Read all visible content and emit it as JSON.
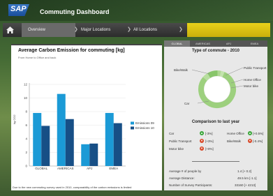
{
  "header": {
    "logo_text": "SAP",
    "title": "Commuting Dashboard"
  },
  "nav": {
    "items": [
      {
        "label": "Overview",
        "active": true
      },
      {
        "label": "Major Locations",
        "active": false
      },
      {
        "label": "All Locations",
        "active": false
      }
    ]
  },
  "left_panel": {
    "title": "Average Carbon Emission for commuting [kg]",
    "subtitle": "From Home to Office and back",
    "footnote": "Due to the new commuting survey used in 2010, comparability of the carbon emissions is limited"
  },
  "right_panel": {
    "tabs": [
      "GLOBAL",
      "AMERICAS",
      "APJ",
      "EMEA"
    ],
    "active_tab": "GLOBAL",
    "donut_title": "Type of commute - 2010",
    "donut_labels": [
      "Bike/Walk",
      "Public Transport",
      "Home Office",
      "Motor bike",
      "Car"
    ],
    "compare_title": "Comparison to last year",
    "comparison": [
      {
        "label": "Car",
        "value": "[-3%]",
        "trend": "up"
      },
      {
        "label": "Home Office",
        "value": "[+0.5%]",
        "trend": "up"
      },
      {
        "label": "Public Transport",
        "value": "[+3%]",
        "trend": "down"
      },
      {
        "label": "Bike/Walk",
        "value": "[-0.4%]",
        "trend": "down"
      },
      {
        "label": "Motor bike",
        "value": "[+0%]",
        "trend": "down"
      }
    ],
    "stats": [
      {
        "label": "Average # of people by",
        "value": "1.4 [+ 0.2]"
      },
      {
        "label": "Average Distance:",
        "value": "49.5 km [-1.1]"
      },
      {
        "label": "Number of Survey Participants:",
        "value": "33160 [+ 4213]"
      }
    ]
  },
  "colors": {
    "series09": "#1b9ad6",
    "series10": "#174f86",
    "donut": "#9cd07e",
    "badge_green": "#3aa63a",
    "badge_red": "#d84a2a"
  },
  "chart_data": {
    "type": "bar",
    "title": "Average Carbon Emission for commuting [kg]",
    "subtitle": "From Home to Office and back",
    "xlabel": "",
    "ylabel": "kg CO2",
    "ylim": [
      0,
      12
    ],
    "yticks": [
      0,
      2,
      4,
      6,
      8,
      10,
      12
    ],
    "categories": [
      "GLOBAL",
      "AMERICAS",
      "APJ",
      "EMEA"
    ],
    "series": [
      {
        "name": "Emissions 09",
        "values": [
          7.8,
          10.6,
          3.2,
          7.8
        ]
      },
      {
        "name": "Emissions 10",
        "values": [
          5.9,
          6.9,
          3.3,
          6.3
        ]
      }
    ],
    "legend": "right"
  },
  "donut_data": {
    "type": "pie",
    "title": "Type of commute - 2010",
    "labels": [
      "Car",
      "Bike/Walk",
      "Public Transport",
      "Home Office",
      "Motor bike"
    ],
    "values": [
      80,
      5,
      9,
      3,
      3
    ]
  }
}
